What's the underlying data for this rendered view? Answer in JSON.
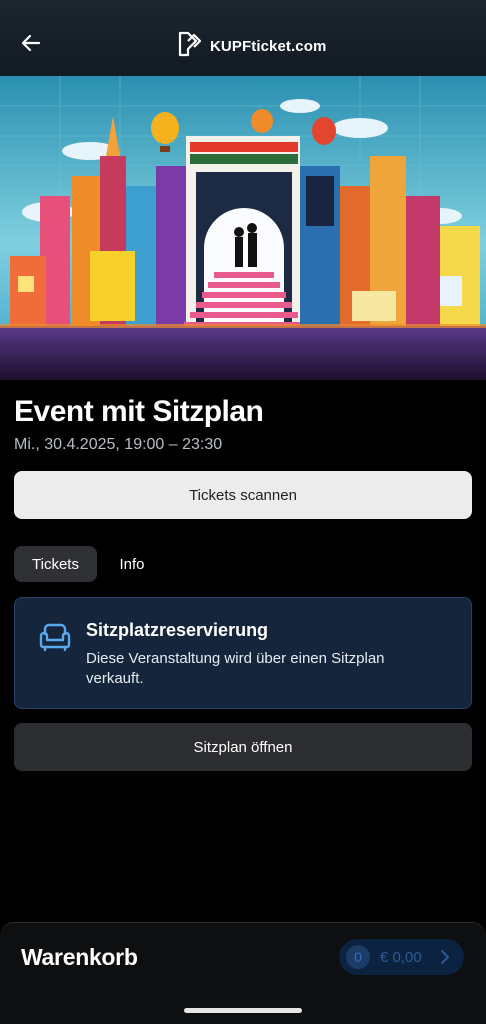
{
  "header": {
    "back_icon": "arrow-left-icon",
    "logo_icon": "kupf-logo-icon",
    "logo_text": "KUPFticket.com"
  },
  "hero": {
    "image": "colorful-city-illustration"
  },
  "event": {
    "title": "Event mit Sitzplan",
    "date": "Mi., 30.4.2025, 19:00 – 23:30"
  },
  "actions": {
    "scan_label": "Tickets scannen"
  },
  "tabs": [
    {
      "label": "Tickets",
      "active": true
    },
    {
      "label": "Info",
      "active": false
    }
  ],
  "seating": {
    "icon": "armchair-icon",
    "title": "Sitzplatzreservierung",
    "description": "Diese Veranstaltung wird über einen Sitzplan verkauft.",
    "open_label": "Sitzplan öffnen"
  },
  "cart": {
    "title": "Warenkorb",
    "count": "0",
    "amount": "€ 0,00",
    "chevron_icon": "chevron-right-icon"
  },
  "colors": {
    "accent": "#1c3c68",
    "card_bg": "#15253c",
    "card_border": "#24436c"
  }
}
